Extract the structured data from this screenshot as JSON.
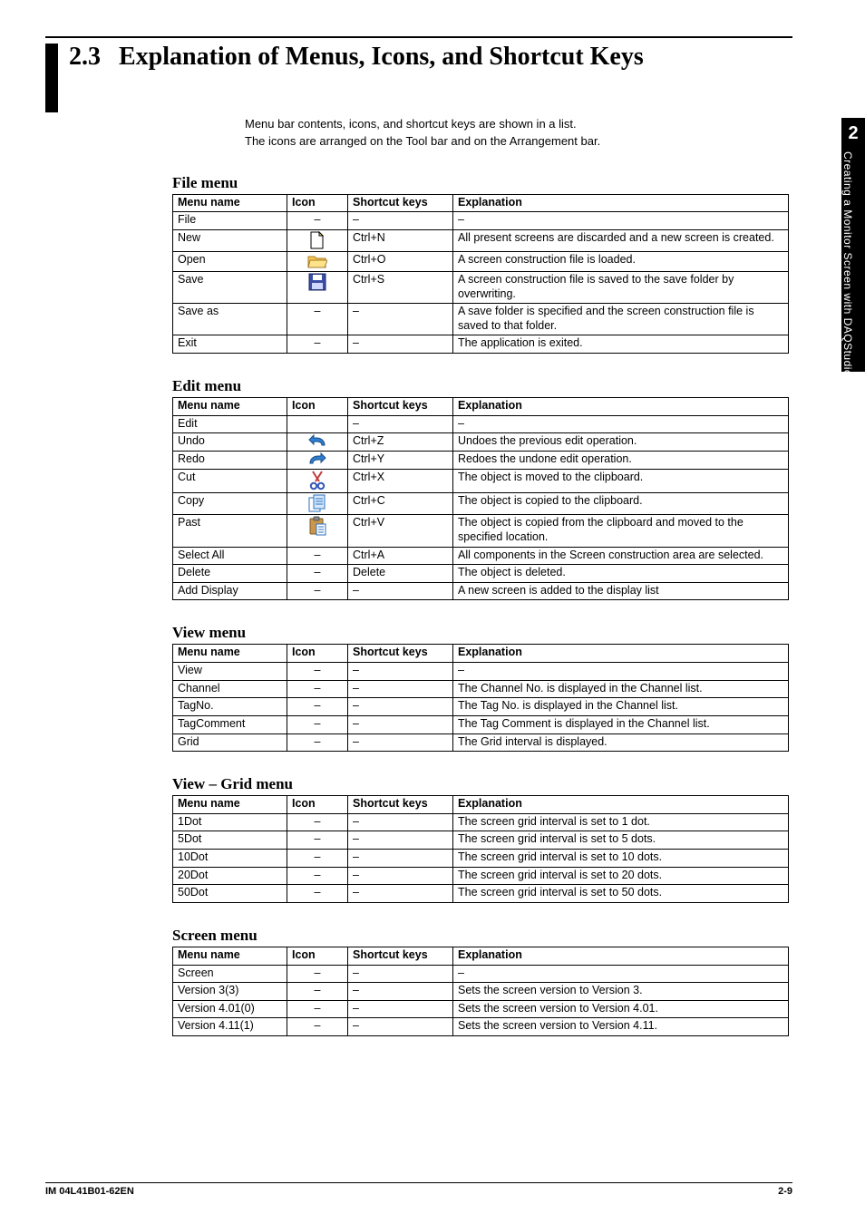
{
  "chapter_tab": {
    "number": "2",
    "label": "Creating a Monitor Screen with DAQStudio"
  },
  "section": {
    "number": "2.3",
    "title": "Explanation of Menus, Icons, and Shortcut Keys"
  },
  "intro": [
    "Menu bar contents, icons, and shortcut keys are shown in a list.",
    "The icons are arranged on the Tool bar and on the Arrangement bar."
  ],
  "table_head": {
    "c0": "Menu name",
    "c1": "Icon",
    "c2": "Shortcut keys",
    "c3": "Explanation"
  },
  "tables": [
    {
      "title": "File menu",
      "rows": [
        {
          "name": "File",
          "icon": "dash",
          "sc": "–",
          "exp": "–"
        },
        {
          "name": "New",
          "icon": "new",
          "sc": "Ctrl+N",
          "exp": "All present screens are discarded and a new screen is created."
        },
        {
          "name": "Open",
          "icon": "open",
          "sc": "Ctrl+O",
          "exp": "A screen construction file is loaded."
        },
        {
          "name": "Save",
          "icon": "save",
          "sc": "Ctrl+S",
          "exp": "A screen construction file is saved to the save folder by overwriting."
        },
        {
          "name": "Save as",
          "icon": "dash",
          "sc": "–",
          "exp": "A save folder is specified and the screen construction file is saved to that folder."
        },
        {
          "name": "Exit",
          "icon": "dash",
          "sc": "–",
          "exp": "The application is exited."
        }
      ]
    },
    {
      "title": "Edit menu",
      "rows": [
        {
          "name": "Edit",
          "icon": "blank",
          "sc": "–",
          "exp": "–"
        },
        {
          "name": "Undo",
          "icon": "undo",
          "sc": "Ctrl+Z",
          "exp": "Undoes the previous edit operation."
        },
        {
          "name": "Redo",
          "icon": "redo",
          "sc": "Ctrl+Y",
          "exp": "Redoes the undone edit operation."
        },
        {
          "name": "Cut",
          "icon": "cut",
          "sc": "Ctrl+X",
          "exp": "The object is moved to the clipboard."
        },
        {
          "name": "Copy",
          "icon": "copy",
          "sc": "Ctrl+C",
          "exp": "The object is copied to the clipboard."
        },
        {
          "name": "Past",
          "icon": "paste",
          "sc": "Ctrl+V",
          "exp": "The object is copied from the clipboard and moved to the specified location."
        },
        {
          "name": "Select All",
          "icon": "dash",
          "sc": "Ctrl+A",
          "exp": "All components in the Screen construction area are selected."
        },
        {
          "name": "Delete",
          "icon": "dash",
          "sc": "Delete",
          "exp": "The object is deleted."
        },
        {
          "name": "Add Display",
          "icon": "dash",
          "sc": "–",
          "exp": "A new screen is added to the display list"
        }
      ]
    },
    {
      "title": "View menu",
      "rows": [
        {
          "name": "View",
          "icon": "dash",
          "sc": "–",
          "exp": "–"
        },
        {
          "name": "Channel",
          "icon": "dash",
          "sc": "–",
          "exp": "The Channel No. is displayed in the Channel list."
        },
        {
          "name": "TagNo.",
          "icon": "dash",
          "sc": "–",
          "exp": "The Tag No. is displayed in the Channel list."
        },
        {
          "name": "TagComment",
          "icon": "dash",
          "sc": "–",
          "exp": "The Tag Comment is displayed in the Channel list."
        },
        {
          "name": "Grid",
          "icon": "dash",
          "sc": "–",
          "exp": "The Grid interval is displayed."
        }
      ]
    },
    {
      "title": "View – Grid menu",
      "rows": [
        {
          "name": "1Dot",
          "icon": "dash",
          "sc": "–",
          "exp": "The screen grid interval is set to 1 dot."
        },
        {
          "name": "5Dot",
          "icon": "dash",
          "sc": "–",
          "exp": "The screen grid interval is set to 5 dots."
        },
        {
          "name": "10Dot",
          "icon": "dash",
          "sc": "–",
          "exp": "The screen grid interval is set to 10 dots."
        },
        {
          "name": "20Dot",
          "icon": "dash",
          "sc": "–",
          "exp": "The screen grid interval is set to 20 dots."
        },
        {
          "name": "50Dot",
          "icon": "dash",
          "sc": "–",
          "exp": "The screen grid interval is set to 50 dots."
        }
      ]
    },
    {
      "title": "Screen menu",
      "rows": [
        {
          "name": "Screen",
          "icon": "dash",
          "sc": "–",
          "exp": "–"
        },
        {
          "name": "Version 3(3)",
          "icon": "dash",
          "sc": "–",
          "exp": "Sets the screen version to Version 3."
        },
        {
          "name": "Version 4.01(0)",
          "icon": "dash",
          "sc": "–",
          "exp": "Sets the screen version to Version 4.01."
        },
        {
          "name": "Version 4.11(1)",
          "icon": "dash",
          "sc": "–",
          "exp": "Sets the screen version to Version 4.11."
        }
      ]
    }
  ],
  "footer": {
    "left": "IM 04L41B01-62EN",
    "right": "2-9"
  }
}
